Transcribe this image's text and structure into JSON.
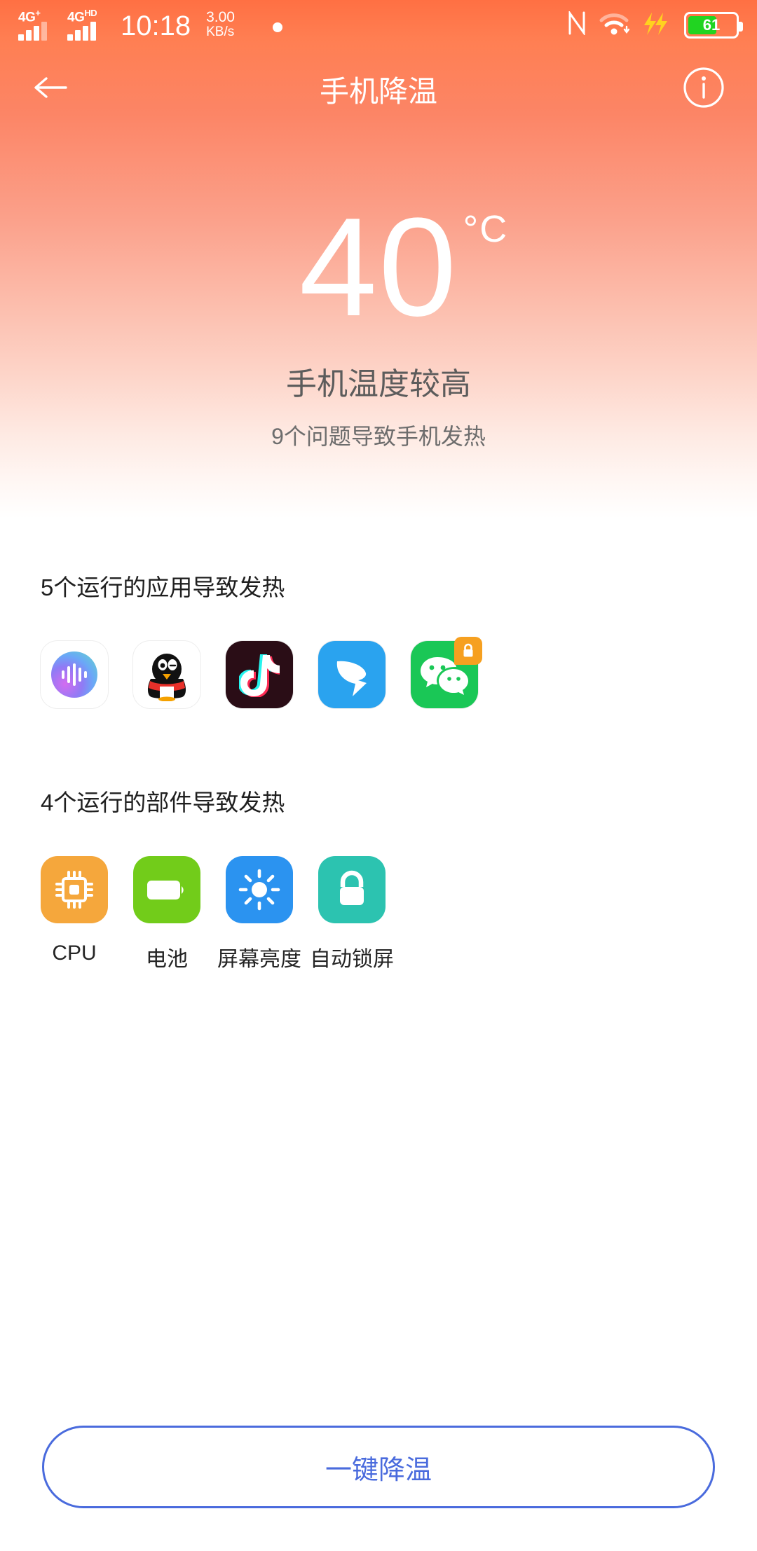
{
  "statusbar": {
    "sim1_label": "4G",
    "sim1_sup": "+",
    "sim2_label": "4G",
    "sim2_sup": "HD",
    "time": "10:18",
    "netspeed_value": "3.00",
    "netspeed_unit": "KB/s",
    "nfc_icon": "nfc-icon",
    "wifi_icon": "wifi-icon",
    "charging_icon": "fast-charging-icon",
    "battery_percent": "61",
    "battery_level": 61
  },
  "appbar": {
    "back_icon": "back-arrow-icon",
    "title": "手机降温",
    "info_icon": "info-icon",
    "info_label": "i"
  },
  "hero": {
    "temperature": "40",
    "unit": "°C",
    "state_text": "手机温度较高",
    "issue_text": "9个问题导致手机发热"
  },
  "apps_section": {
    "title": "5个运行的应用导致发热",
    "items": [
      {
        "name": "小爱同学",
        "icon": "xiaoai-icon",
        "badge": null
      },
      {
        "name": "QQ",
        "icon": "qq-penguin-icon",
        "badge": null
      },
      {
        "name": "抖音",
        "icon": "douyin-icon",
        "badge": null
      },
      {
        "name": "钉钉",
        "icon": "dingtalk-icon",
        "badge": null
      },
      {
        "name": "微信",
        "icon": "wechat-icon",
        "badge": "lock-badge-icon"
      }
    ]
  },
  "parts_section": {
    "title": "4个运行的部件导致发热",
    "items": [
      {
        "label": "CPU",
        "icon": "cpu-icon",
        "color": "#f5a73c"
      },
      {
        "label": "电池",
        "icon": "battery-icon",
        "color": "#72cc1a"
      },
      {
        "label": "屏幕亮度",
        "icon": "brightness-icon",
        "color": "#2b93f0"
      },
      {
        "label": "自动锁屏",
        "icon": "lock-icon",
        "color": "#2cc3b0"
      }
    ]
  },
  "cta": {
    "label": "一键降温",
    "color": "#4a6bdd"
  }
}
